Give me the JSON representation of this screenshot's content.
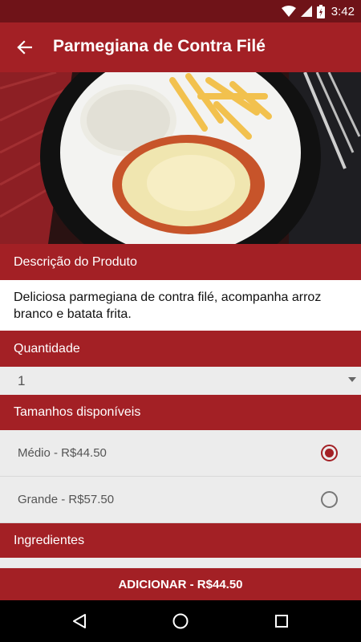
{
  "status_bar": {
    "time": "3:42",
    "icons": [
      "wifi-icon",
      "signal-icon",
      "battery-icon"
    ]
  },
  "app_bar": {
    "title": "Parmegiana de Contra Filé",
    "back_icon": "arrow-back-icon"
  },
  "description": {
    "header": "Descrição do Produto",
    "text": "Deliciosa parmegiana de contra filé, acompanha arroz branco e batata frita."
  },
  "quantity": {
    "header": "Quantidade",
    "selected": "1"
  },
  "sizes": {
    "header": "Tamanhos disponíveis",
    "options": [
      {
        "label": "Médio - R$44.50",
        "selected": true
      },
      {
        "label": "Grande - R$57.50",
        "selected": false
      }
    ]
  },
  "ingredients": {
    "header": "Ingredientes"
  },
  "add_button": {
    "label": "ADICIONAR - R$44.50"
  },
  "nav_bar": {
    "icons": [
      "back-triangle-icon",
      "home-circle-icon",
      "recents-square-icon"
    ]
  },
  "colors": {
    "primary": "#a32025",
    "status_bar": "#6f1318",
    "row_bg": "#ececec"
  }
}
